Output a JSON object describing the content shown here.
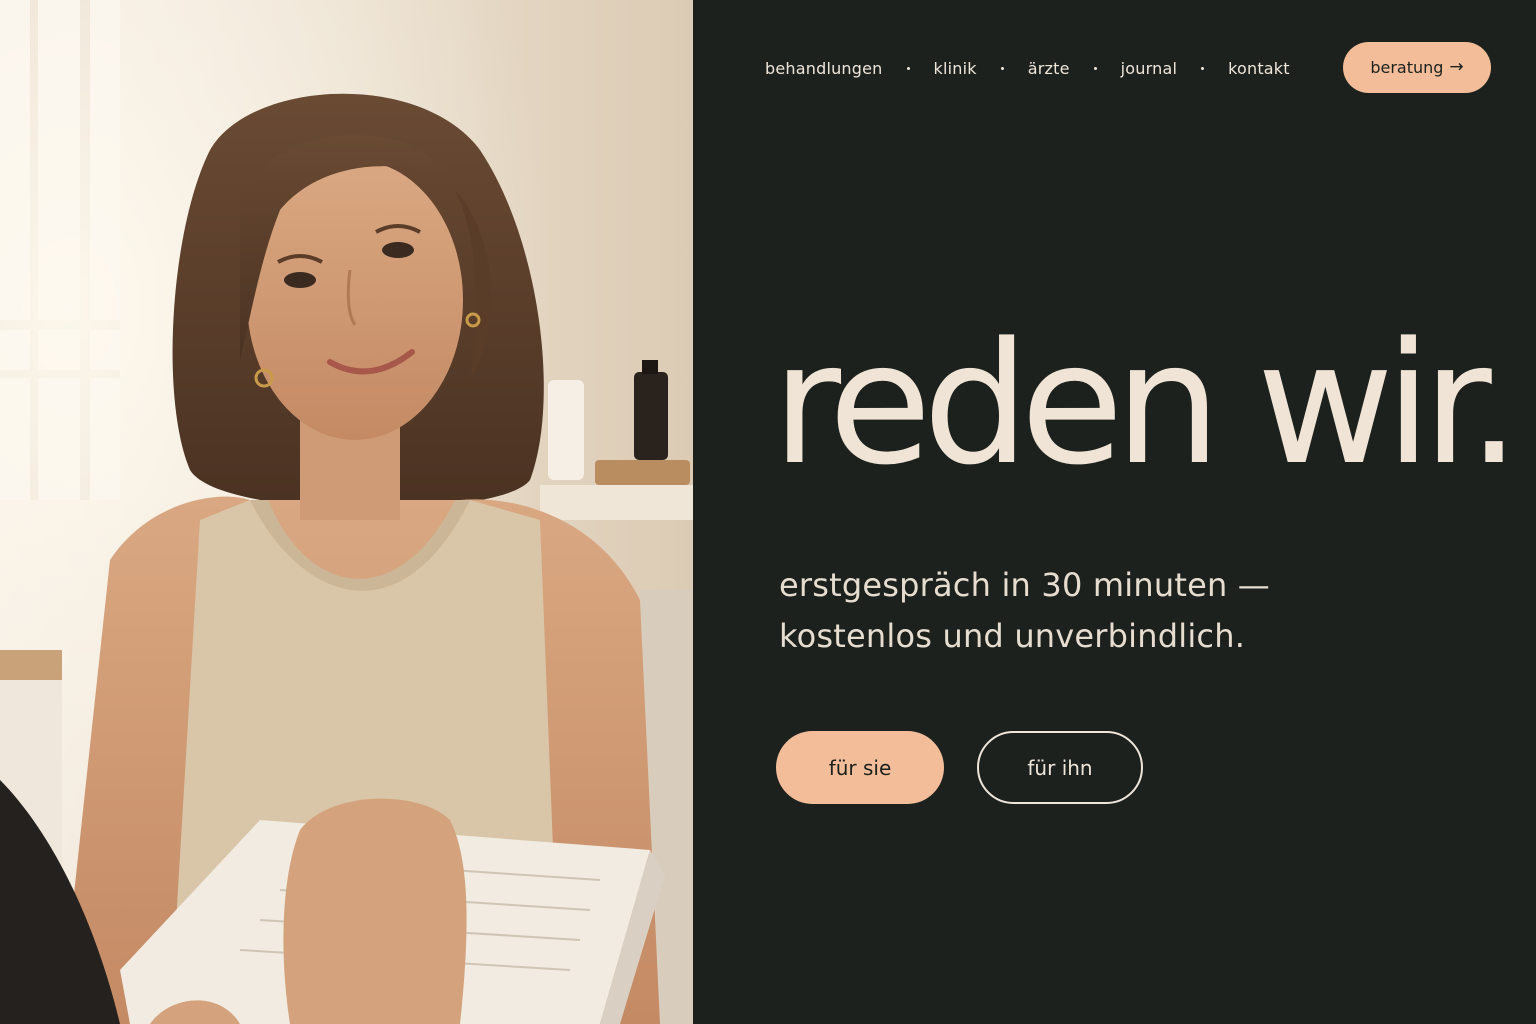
{
  "nav": {
    "items": [
      {
        "label": "behandlungen"
      },
      {
        "label": "klinik"
      },
      {
        "label": "ärzte"
      },
      {
        "label": "journal"
      },
      {
        "label": "kontakt"
      }
    ],
    "cta_label": "beratung",
    "cta_icon": "arrow-right-icon"
  },
  "hero": {
    "headline": "reden wir.",
    "subline_1": "erstgespräch in 30 minuten —",
    "subline_2": "kostenlos und unverbindlich.",
    "button_primary": "für sie",
    "button_secondary": "für ihn"
  },
  "colors": {
    "background": "#1c211e",
    "accent": "#f2bd98",
    "text": "#efe4d6"
  }
}
